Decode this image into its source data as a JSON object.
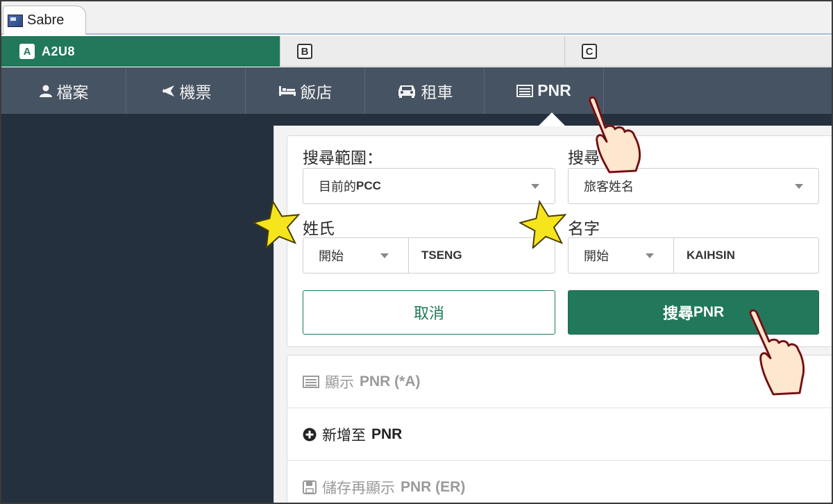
{
  "window": {
    "tab_label": "Sabre"
  },
  "sessions": [
    {
      "letter": "A",
      "name": "A2U8"
    },
    {
      "letter": "B",
      "name": ""
    },
    {
      "letter": "C",
      "name": ""
    }
  ],
  "nav": {
    "profile": "檔案",
    "air": "機票",
    "hotel": "飯店",
    "car": "租車",
    "pnr": "PNR"
  },
  "search": {
    "scope_label": "搜尋範圍：",
    "scope_value_prefix": "目前的 ",
    "scope_value_bold": "PCC",
    "by_label": "搜尋",
    "by_value": "旅客姓名",
    "surname_label": "姓氏",
    "surname_mode": "開始",
    "surname_value": "TSENG",
    "given_label": "名字",
    "given_mode": "開始",
    "given_value": "KAIHSIN",
    "cancel_label": "取消",
    "search_label_prefix": "搜尋 ",
    "search_label_bold": "PNR"
  },
  "actions": [
    {
      "prefix": "顯示 ",
      "bold": "PNR (*A)",
      "icon": "list-icon",
      "enabled": false
    },
    {
      "prefix": "新增至 ",
      "bold": "PNR",
      "icon": "plus-circle-icon",
      "enabled": true
    },
    {
      "prefix": "儲存再顯示 ",
      "bold": "PNR (ER)",
      "icon": "save-icon",
      "enabled": false
    }
  ],
  "colors": {
    "accent": "#21785a",
    "nav_bg": "#465362",
    "body_bg": "#24303e",
    "annotation_star": "#f6e51c",
    "hand_highlight": "#e8141c"
  }
}
